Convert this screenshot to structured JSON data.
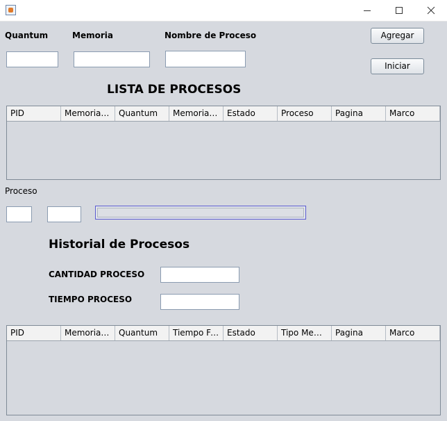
{
  "window": {
    "icon": "java-icon",
    "minimize_icon": "minimize-icon",
    "maximize_icon": "maximize-icon",
    "close_icon": "close-icon"
  },
  "form": {
    "quantum_label": "Quantum",
    "memoria_label": "Memoria",
    "nombre_label": "Nombre de Proceso",
    "quantum_value": "",
    "memoria_value": "",
    "nombre_value": "",
    "agregar_button": "Agregar",
    "iniciar_button": "Iniciar"
  },
  "lista": {
    "title": "LISTA DE PROCESOS",
    "columns": [
      "PID",
      "Memoria ...",
      "Quantum",
      "Memoria ...",
      "Estado",
      "Proceso",
      "Pagina",
      "Marco"
    ],
    "rows": []
  },
  "proceso": {
    "label": "Proceso",
    "field1_value": "",
    "field2_value": "",
    "progress": 0
  },
  "historial": {
    "title": "Historial de Procesos",
    "cantidad_label": "CANTIDAD PROCESO",
    "tiempo_label": "TIEMPO PROCESO",
    "cantidad_value": "",
    "tiempo_value": "",
    "columns": [
      "PID",
      "Memoria T...",
      "Quantum",
      "Tiempo Fi...",
      "Estado",
      "Tipo Mem...",
      "Pagina",
      "Marco"
    ],
    "rows": []
  },
  "colors": {
    "background": "#d6d9df",
    "progress_border": "#5a5ad0"
  }
}
